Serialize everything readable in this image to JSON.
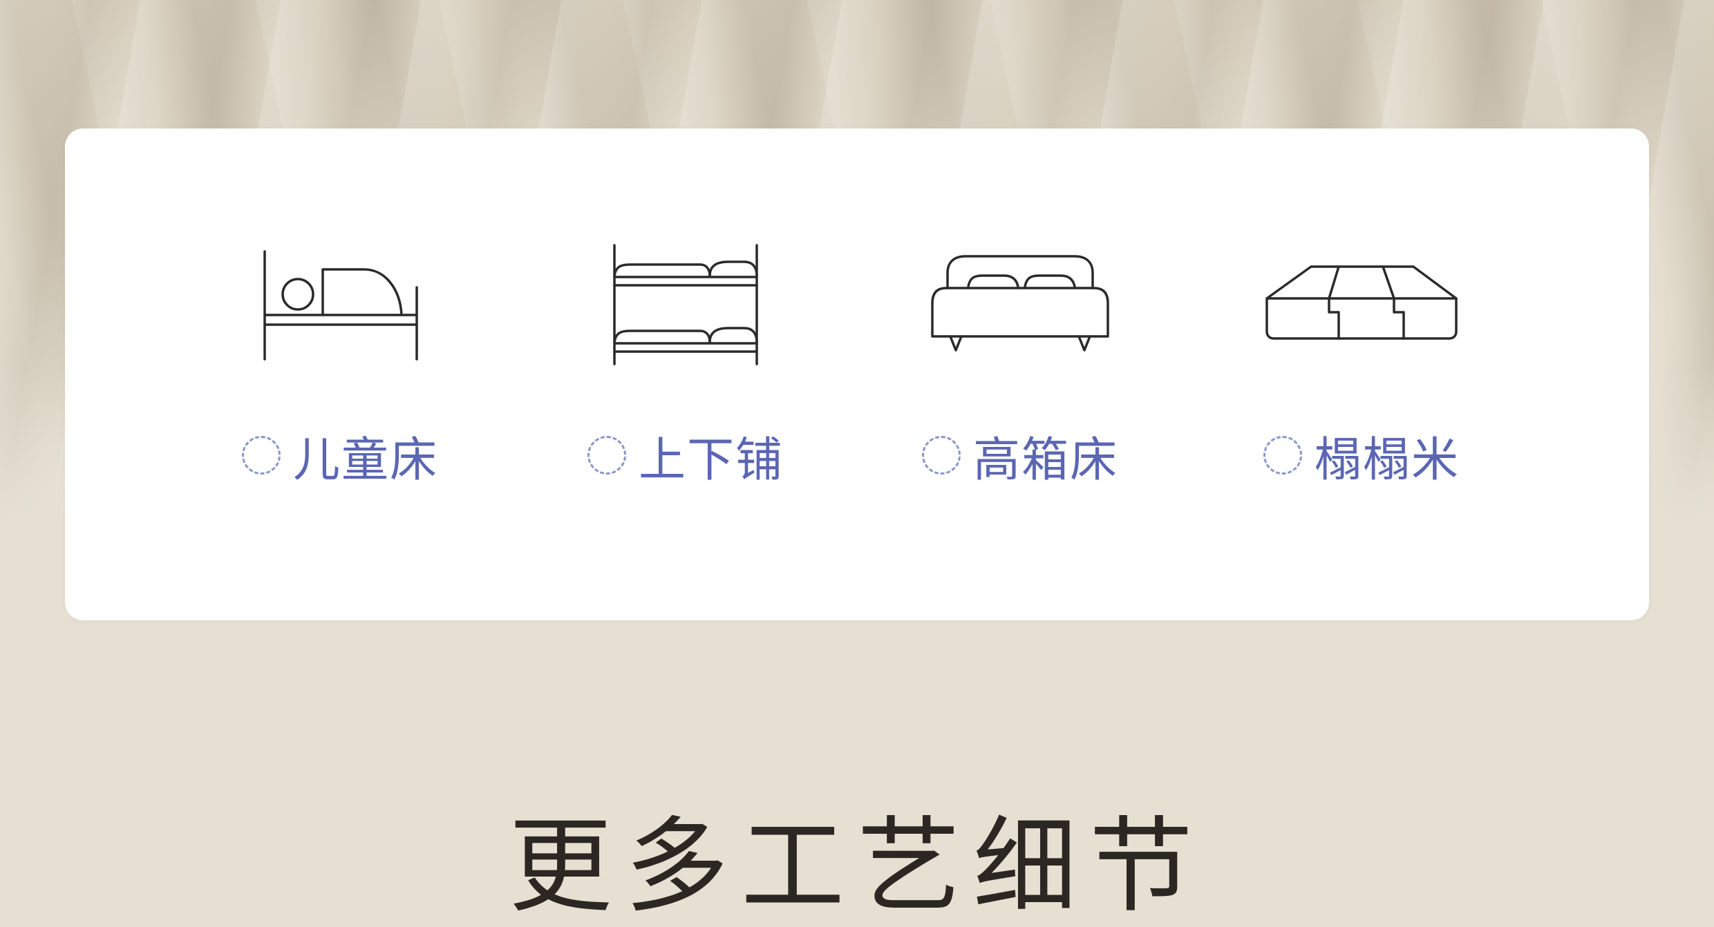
{
  "options": [
    {
      "label": "儿童床",
      "icon": "kids-bed-icon"
    },
    {
      "label": "上下铺",
      "icon": "bunk-bed-icon"
    },
    {
      "label": "高箱床",
      "icon": "storage-bed-icon"
    },
    {
      "label": "榻榻米",
      "icon": "tatami-icon"
    }
  ],
  "headline": "更多工艺细节",
  "colors": {
    "label": "#5b66b3",
    "radio_border": "#8b96c9",
    "icon_stroke": "#2a2a2a",
    "card": "#ffffff",
    "page_background": "#e6e0d2",
    "headline": "#2c2722"
  }
}
